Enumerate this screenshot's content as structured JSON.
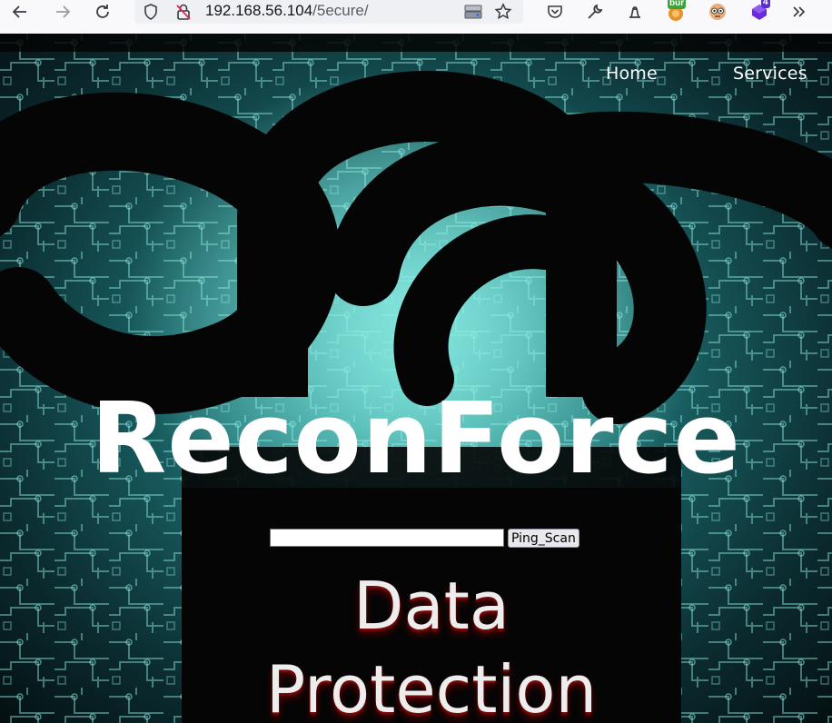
{
  "browser": {
    "url_host": "192.168.56.104",
    "url_path": "/5ecure/",
    "toolbar_icons": [
      "back-icon",
      "forward-icon",
      "reload-icon",
      "shield-icon",
      "insecure-lock-icon",
      "page-action-icon",
      "bookmark-star-icon",
      "pocket-icon",
      "wrench-icon",
      "extension-icon",
      "burp-extension-icon",
      "extension-face-icon",
      "extension-badge-icon",
      "overflow-chevrons-icon"
    ],
    "ext_burp_label": "bur",
    "ext_badge_count": "4"
  },
  "nav": {
    "home": "Home",
    "services": "Services"
  },
  "hero": {
    "title": "ReconForce"
  },
  "ping": {
    "input_value": "",
    "button_label": "Ping_Scan"
  },
  "banner": {
    "line1": "Data",
    "line2": "Protection"
  },
  "colors": {
    "circuit_teal": "#2f8f8e",
    "chain_black": "#050505",
    "title_white": "#ffffff"
  }
}
